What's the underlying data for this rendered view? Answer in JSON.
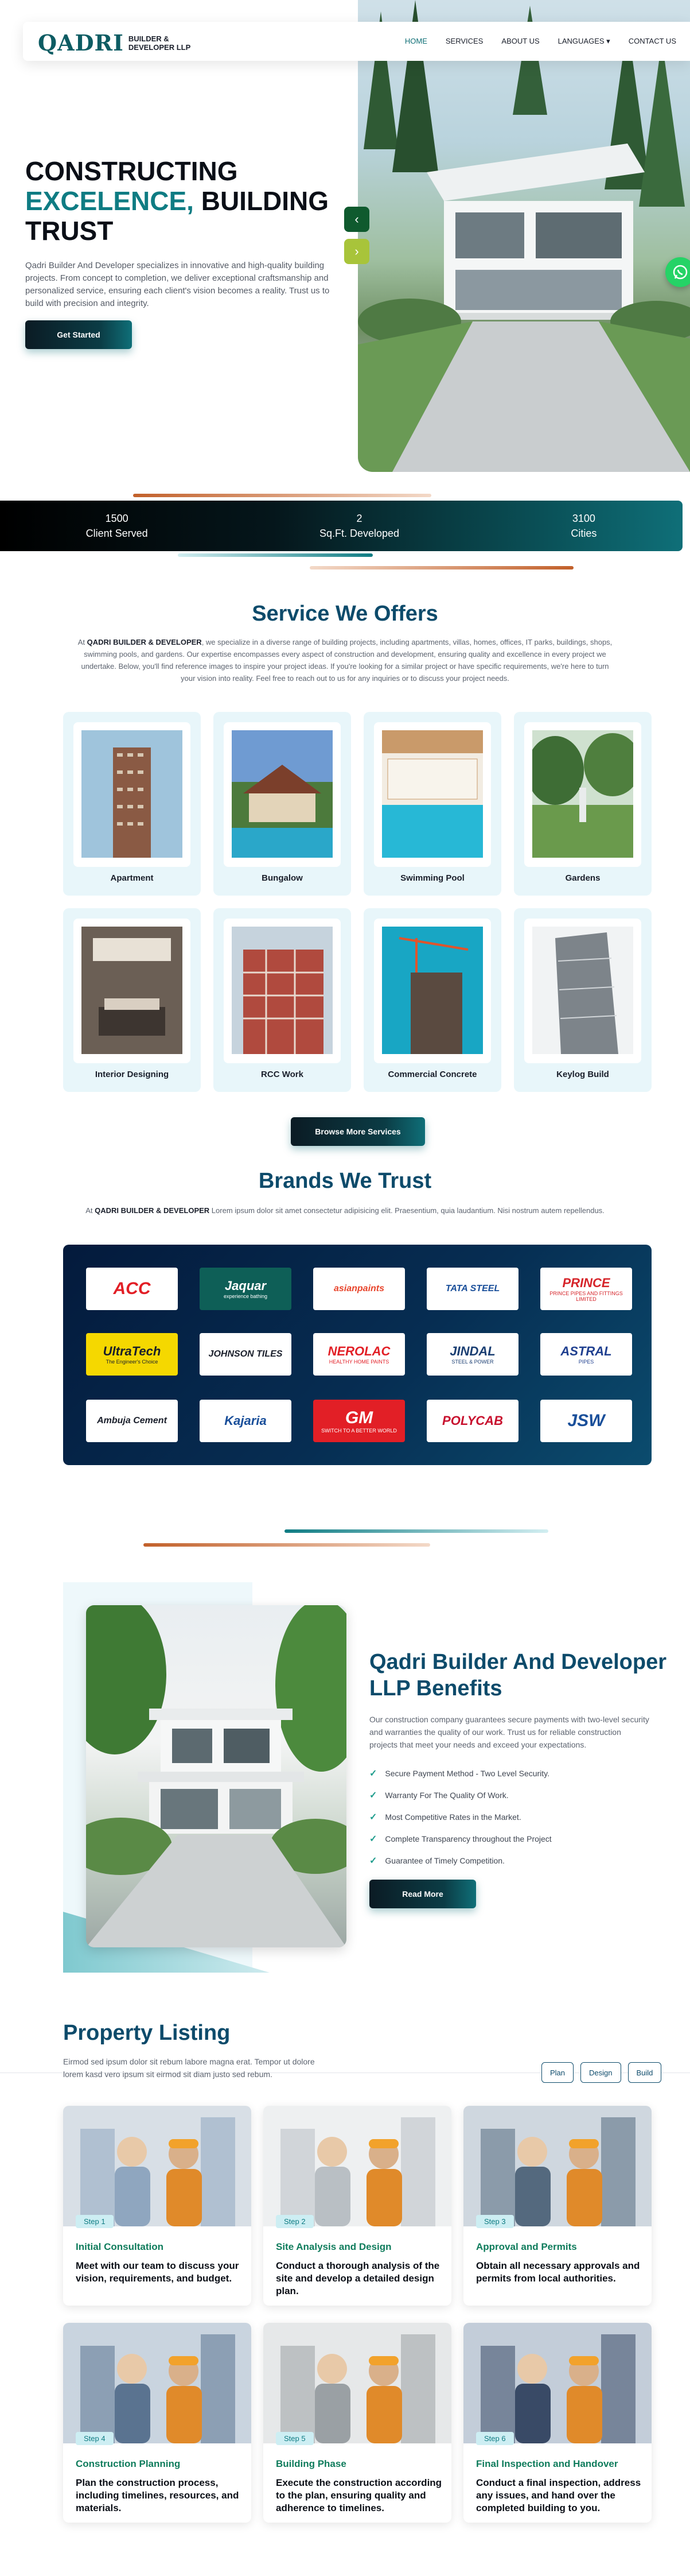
{
  "brand": {
    "name": "QADRI",
    "tagline": "BUILDER & DEVELOPER LLP"
  },
  "nav": {
    "items": [
      "HOME",
      "SERVICES",
      "ABOUT US",
      "LANGUAGES ▾",
      "CONTACT US"
    ],
    "active": "HOME"
  },
  "hero": {
    "title_line1": "CONSTRUCTING",
    "title_accent": "EXCELENCE,",
    "title_rest": " BUILDING",
    "title_line3": "TRUST",
    "description": "Qadri Builder And Developer specializes in innovative and high-quality building projects. From concept to completion, we deliver exceptional craftsmanship and personalized service, ensuring each client's vision becomes a reality. Trust us to build with precision and integrity.",
    "cta": "Get Started",
    "prev_icon": "‹",
    "next_icon": "›"
  },
  "stats": [
    {
      "value": "1500",
      "label": "Client Served"
    },
    {
      "value": "2",
      "label": "Sq.Ft. Developed"
    },
    {
      "value": "3100",
      "label": "Cities"
    }
  ],
  "services": {
    "title": "Service We Offers",
    "desc_brand": "QADRI BUILDER & DEVELOPER",
    "desc_before": "At ",
    "desc_after": ", we specialize in a diverse range of building projects, including apartments, villas, homes, offices, IT parks, buildings, shops, swimming pools, and gardens. Our expertise encompasses every aspect of construction and development, ensuring quality and excellence in every project we undertake. Below, you'll find reference images to inspire your project ideas. If you're looking for a similar project or have specific requirements, we're here to turn your vision into reality. Feel free to reach out to us for any inquiries or to discuss your project needs.",
    "items": [
      "Apartment",
      "Bungalow",
      "Swimming Pool",
      "Gardens",
      "Interior Designing",
      "RCC Work",
      "Commercial Concrete",
      "Keylog Build"
    ],
    "browse": "Browse More Services"
  },
  "brands": {
    "title": "Brands We Trust",
    "desc_before": "At ",
    "desc_brand": "QADRI BUILDER & DEVELOPER",
    "desc_after": " Lorem ipsum dolor sit amet consectetur adipisicing elit. Praesentium, quia laudantium. Nisi nostrum autem repellendus.",
    "logos": [
      {
        "text": "ACC",
        "sub": "",
        "bg": "#ffffff",
        "color": "#e21f26"
      },
      {
        "text": "Jaquar",
        "sub": "experience bathing",
        "bg": "#0e5f57",
        "color": "#ffffff"
      },
      {
        "text": "asianpaints",
        "sub": "",
        "bg": "#ffffff",
        "color": "#e8452c"
      },
      {
        "text": "TATA STEEL",
        "sub": "",
        "bg": "#ffffff",
        "color": "#1a4f9a"
      },
      {
        "text": "PRINCE",
        "sub": "PRINCE PIPES AND FITTINGS LIMITED",
        "bg": "#ffffff",
        "color": "#d6242a"
      },
      {
        "text": "UltraTech",
        "sub": "The Engineer's Choice",
        "bg": "#f5d800",
        "color": "#1a1f2b"
      },
      {
        "text": "JOHNSON TILES",
        "sub": "",
        "bg": "#ffffff",
        "color": "#1a1f2b"
      },
      {
        "text": "NEROLAC",
        "sub": "HEALTHY HOME PAINTS",
        "bg": "#ffffff",
        "color": "#e21f26"
      },
      {
        "text": "JINDAL",
        "sub": "STEEL & POWER",
        "bg": "#ffffff",
        "color": "#1a3e72"
      },
      {
        "text": "ASTRAL",
        "sub": "PIPES",
        "bg": "#ffffff",
        "color": "#1f3f8f"
      },
      {
        "text": "Ambuja Cement",
        "sub": "",
        "bg": "#ffffff",
        "color": "#1a1f2b"
      },
      {
        "text": "Kajaria",
        "sub": "",
        "bg": "#ffffff",
        "color": "#1a4f9a"
      },
      {
        "text": "GM",
        "sub": "SWITCH TO A BETTER WORLD",
        "bg": "#e21f26",
        "color": "#ffffff"
      },
      {
        "text": "POLYCAB",
        "sub": "",
        "bg": "#ffffff",
        "color": "#c8102e"
      },
      {
        "text": "JSW",
        "sub": "",
        "bg": "#ffffff",
        "color": "#1a4f9a"
      }
    ]
  },
  "benefits": {
    "title": "Qadri Builder And Developer LLP Benefits",
    "description": "Our construction company guarantees secure payments with two-level security and warranties the quality of our work. Trust us for reliable construction projects that meet your needs and exceed your expectations.",
    "items": [
      "Secure Payment Method - Two Level Security.",
      "Warranty For The Quality Of Work.",
      "Most Competitive Rates in the Market.",
      "Complete Transparency throughout the Project",
      "Guarantee of Timely Competition."
    ],
    "cta": "Read More",
    "check_icon": "✓"
  },
  "property": {
    "title": "Property Listing",
    "description": "Eirmod sed ipsum dolor sit rebum labore magna erat. Tempor ut dolore lorem kasd vero ipsum sit eirmod sit diam justo sed rebum.",
    "filters": [
      "Plan",
      "Design",
      "Build"
    ],
    "steps": [
      {
        "badge": "Step 1",
        "name": "Initial Consultation",
        "text": "Meet with our team to discuss your vision, requirements, and budget."
      },
      {
        "badge": "Step 2",
        "name": "Site Analysis and Design",
        "text": "Conduct a thorough analysis of the site and develop a detailed design plan."
      },
      {
        "badge": "Step 3",
        "name": "Approval and Permits",
        "text": "Obtain all necessary approvals and permits from local authorities."
      },
      {
        "badge": "Step 4",
        "name": "Construction Planning",
        "text": "Plan the construction process, including timelines, resources, and materials."
      },
      {
        "badge": "Step 5",
        "name": "Building Phase",
        "text": "Execute the construction according to the plan, ensuring quality and adherence to timelines."
      },
      {
        "badge": "Step 6",
        "name": "Final Inspection and Handover",
        "text": "Conduct a final inspection, address any issues, and hand over the completed building to you."
      }
    ]
  },
  "colors": {
    "teal": "#0f7c83",
    "navy": "#0d4b6b",
    "copper": "#b5562a",
    "whatsapp": "#25d366"
  },
  "icons": {
    "whatsapp": "whatsapp-icon",
    "check": "check-icon",
    "arrow_left": "arrow-left-icon",
    "arrow_right": "arrow-right-icon"
  }
}
